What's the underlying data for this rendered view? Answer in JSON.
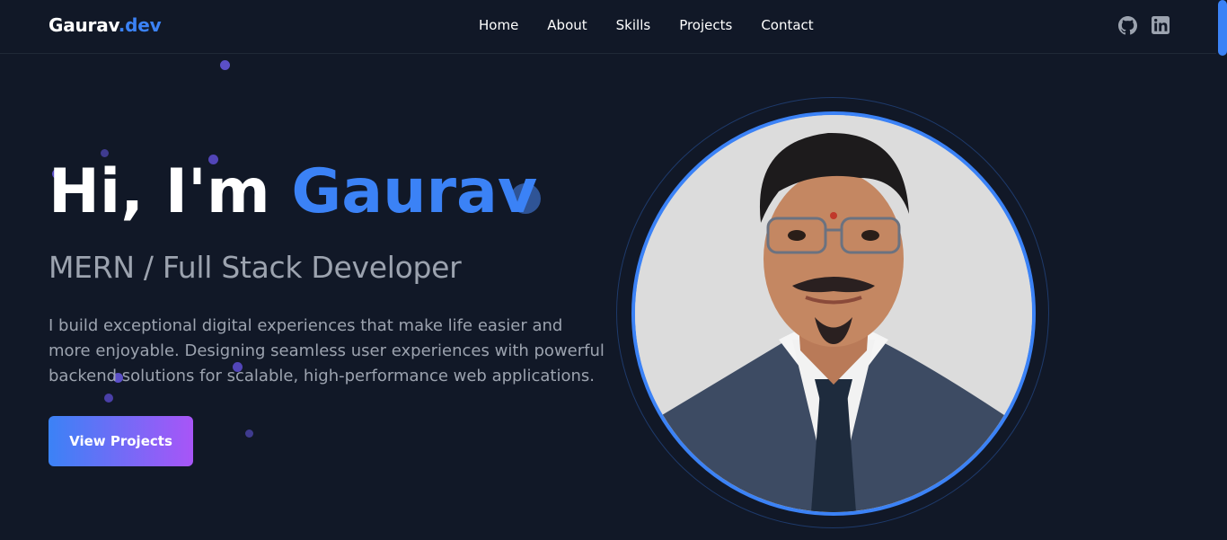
{
  "header": {
    "logo_main": "Gaurav",
    "logo_accent": ".dev",
    "nav": [
      "Home",
      "About",
      "Skills",
      "Projects",
      "Contact"
    ],
    "social_icons": [
      "github-icon",
      "linkedin-icon"
    ]
  },
  "hero": {
    "greeting": "Hi, I'm",
    "name": "Gaurav",
    "subtitle": "MERN / Full Stack Developer",
    "description": "I build exceptional digital experiences that make life easier and more enjoyable. Designing seamless user experiences with powerful backend solutions for scalable, high-performance web applications.",
    "cta_label": "View Projects"
  },
  "colors": {
    "background": "#111827",
    "accent": "#3b82f6",
    "gradient_end": "#a855f7",
    "muted_text": "#9ca3af"
  }
}
